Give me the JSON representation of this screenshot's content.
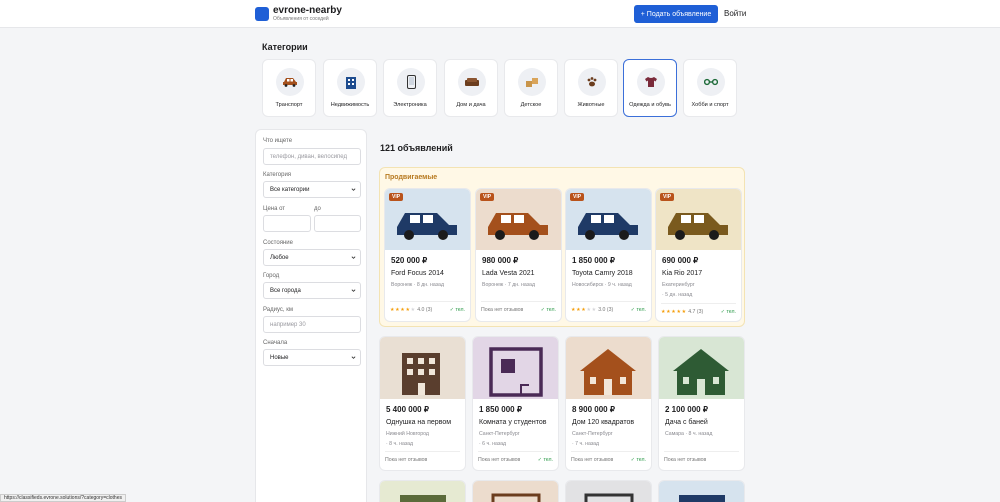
{
  "header": {
    "logo_name": "evrone-nearby",
    "logo_tagline": "Объявления от соседей",
    "post_button": "+ Подать объявление",
    "login": "Войти",
    "logo_color": "#1f5fd6"
  },
  "categories": {
    "title": "Категории",
    "items": [
      {
        "label": "Транспорт",
        "icon": "car-icon"
      },
      {
        "label": "Недвижимость",
        "icon": "building-icon"
      },
      {
        "label": "Электроника",
        "icon": "phone-icon"
      },
      {
        "label": "Дом и дача",
        "icon": "sofa-icon"
      },
      {
        "label": "Детское",
        "icon": "toys-icon"
      },
      {
        "label": "Животные",
        "icon": "paw-icon"
      },
      {
        "label": "Одежда и обувь",
        "icon": "tshirt-icon",
        "active": true
      },
      {
        "label": "Хобби и спорт",
        "icon": "dumbbell-icon"
      }
    ]
  },
  "filters": {
    "query_label": "Что ищете",
    "query_placeholder": "телефон, диван, велосипед",
    "category_label": "Категория",
    "category_value": "Все категории",
    "price_from_label": "Цена от",
    "price_to_label": "до",
    "condition_label": "Состояние",
    "condition_value": "Любое",
    "city_label": "Город",
    "city_value": "Все города",
    "radius_label": "Радиус, км",
    "radius_placeholder": "например 30",
    "sort_label": "Сначала",
    "sort_value": "Новые"
  },
  "results": {
    "count": "121 объявлений",
    "promoted_title": "Продвигаемые",
    "vip_badge": "VIP"
  },
  "promoted": [
    {
      "price": "520 000 ₽",
      "title": "Ford Focus 2014",
      "meta1": "Воронеж · 8 дн. назад",
      "meta2": "",
      "rating": "4.0",
      "reviews": "(3)",
      "tel": "✓ тел.",
      "stars": 4,
      "img_bg": "#d6e3ee",
      "car_color": "#1f3a66"
    },
    {
      "price": "980 000 ₽",
      "title": "Lada Vesta 2021",
      "meta1": "Воронеж · 7 дн. назад",
      "meta2": "",
      "rating": "",
      "reviews": "",
      "no_reviews": "Пока нет отзывов",
      "tel": "✓ тел.",
      "img_bg": "#ecdccd",
      "car_color": "#a4501c"
    },
    {
      "price": "1 850 000 ₽",
      "title": "Toyota Camry 2018",
      "meta1": "Новосибирск · 9 ч. назад",
      "meta2": "",
      "rating": "3.0",
      "reviews": "(3)",
      "tel": "✓ тел.",
      "stars": 3,
      "img_bg": "#d6e3ee",
      "car_color": "#1f3a66"
    },
    {
      "price": "690 000 ₽",
      "title": "Kia Rio 2017",
      "meta1": "Екатеринбург",
      "meta2": "· 5 дн. назад",
      "rating": "4.7",
      "reviews": "(3)",
      "tel": "✓ тел.",
      "stars": 5,
      "img_bg": "#efe4c6",
      "car_color": "#7a5a1e"
    }
  ],
  "listings": [
    {
      "price": "5 400 000 ₽",
      "title": "Однушка на первом",
      "meta1": "Нижний Новгород",
      "meta2": "· 8 ч. назад",
      "foot": "Пока нет отзывов",
      "tel": "",
      "img_bg": "#e9dfd3"
    },
    {
      "price": "1 850 000 ₽",
      "title": "Комната у студентов",
      "meta1": "Санкт-Петербург",
      "meta2": "· 6 ч. назад",
      "foot": "Пока нет отзывов",
      "tel": "✓ тел.",
      "img_bg": "#e2d6e6"
    },
    {
      "price": "8 900 000 ₽",
      "title": "Дом 120 квадратов",
      "meta1": "Санкт-Петербург",
      "meta2": "· 7 ч. назад",
      "foot": "Пока нет отзывов",
      "tel": "✓ тел.",
      "img_bg": "#ecdccd"
    },
    {
      "price": "2 100 000 ₽",
      "title": "Дача с баней",
      "meta1": "Самара · 8 ч. назад",
      "meta2": "",
      "foot": "Пока нет отзывов",
      "tel": "",
      "img_bg": "#d8e6d4"
    }
  ],
  "status_url": "https://classifieds.evrone.solutions/?category=clothes"
}
